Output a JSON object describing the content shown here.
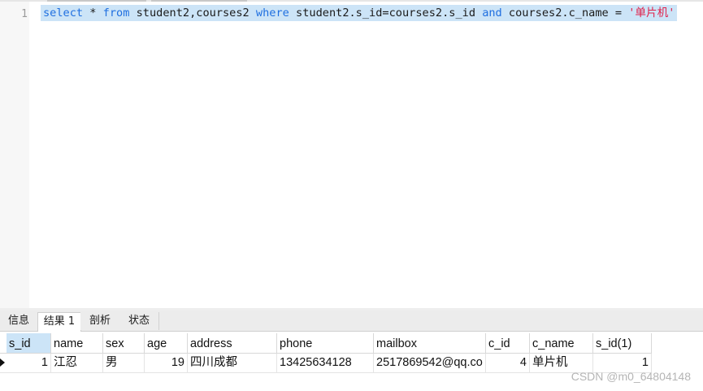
{
  "editor": {
    "line_number": "1",
    "query_tokens": {
      "select": "select",
      "star": " * ",
      "from": "from",
      "tables": " student2,courses2 ",
      "where": "where",
      "condition": " student2.s_id=courses2.s_id ",
      "and": "and",
      "filter": " courses2.c_name = ",
      "value": "'单片机'"
    },
    "colors": {
      "keyword": "#1f6fe0",
      "string": "#e0204a",
      "selection": "#cce4f7"
    }
  },
  "tabs": [
    "信息",
    "结果 1",
    "剖析",
    "状态"
  ],
  "active_tab": "结果 1",
  "table": {
    "columns": [
      "s_id",
      "name",
      "sex",
      "age",
      "address",
      "phone",
      "mailbox",
      "c_id",
      "c_name",
      "s_id(1)"
    ],
    "rows": [
      [
        "1",
        "江忍",
        "男",
        "19",
        "四川成都",
        "13425634128",
        "2517869542@qq.co",
        "4",
        "单片机",
        "1"
      ]
    ]
  },
  "watermark": "CSDN @m0_64804148"
}
